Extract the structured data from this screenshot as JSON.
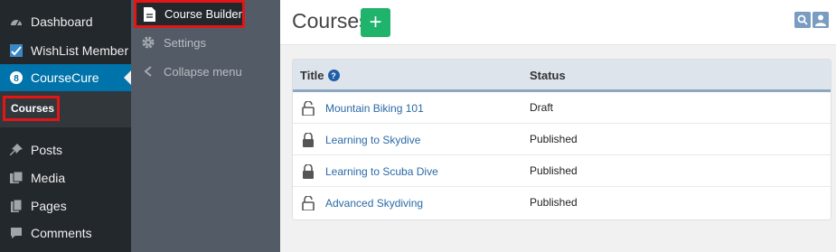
{
  "admin_menu": {
    "items": [
      {
        "label": "Dashboard",
        "icon": "dashboard-icon"
      },
      {
        "label": "WishList Member",
        "icon": "checkmark-icon"
      },
      {
        "label": "CourseCure",
        "icon": "coursecure-icon"
      },
      {
        "label": "Posts",
        "icon": "pin-icon"
      },
      {
        "label": "Media",
        "icon": "media-icon"
      },
      {
        "label": "Pages",
        "icon": "pages-icon"
      },
      {
        "label": "Comments",
        "icon": "comment-icon"
      }
    ],
    "submenu": {
      "courses": "Courses"
    }
  },
  "sub_panel": {
    "builder": "Course Builder",
    "settings": "Settings",
    "collapse": "Collapse menu"
  },
  "header": {
    "title": "Courses",
    "add_label": "+"
  },
  "table": {
    "columns": {
      "title": "Title",
      "help": "?",
      "status": "Status"
    },
    "rows": [
      {
        "title": "Mountain Biking 101",
        "status": "Draft",
        "locked": false
      },
      {
        "title": "Learning to Skydive",
        "status": "Published",
        "locked": true
      },
      {
        "title": "Learning to Scuba Dive",
        "status": "Published",
        "locked": true
      },
      {
        "title": "Advanced Skydiving",
        "status": "Published",
        "locked": false
      }
    ]
  },
  "colors": {
    "accent": "#0073aa",
    "highlight_border": "#e21616",
    "add_button": "#1fb36b",
    "link": "#2a6aa6"
  }
}
